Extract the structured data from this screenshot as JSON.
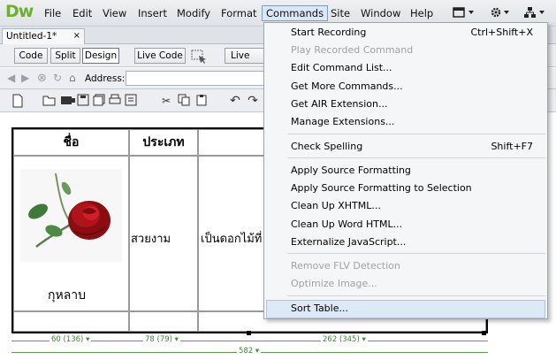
{
  "app": {
    "logo": "Dw"
  },
  "menubar": {
    "items": [
      "File",
      "Edit",
      "View",
      "Insert",
      "Modify",
      "Format",
      "Commands",
      "Site",
      "Window",
      "Help"
    ],
    "icons": [
      "layout-icon",
      "settings-icon",
      "site-icon"
    ]
  },
  "tab": {
    "title": "Untitled-1*",
    "close": "×"
  },
  "doc_toolbar": {
    "code": "Code",
    "split": "Split",
    "design": "Design",
    "live_code": "Live Code",
    "live_view": "Live View"
  },
  "address_bar": {
    "label": "Address:",
    "value": ""
  },
  "table": {
    "headers": [
      "ชื่อ",
      "ประเภท",
      ""
    ],
    "row1": {
      "caption": "กุหลาบ",
      "type": "สวยงาม",
      "desc": "เป็นดอกไม้ที่"
    },
    "widths": {
      "col1": "60 (136)",
      "col2": "78 (79)",
      "col3": "262 (345)",
      "total": "582"
    }
  },
  "commands_menu": {
    "items": [
      {
        "label": "Start Recording",
        "shortcut": "Ctrl+Shift+X",
        "enabled": true
      },
      {
        "label": "Play Recorded Command",
        "shortcut": "",
        "enabled": false
      },
      {
        "label": "Edit Command List...",
        "shortcut": "",
        "enabled": true
      },
      {
        "label": "Get More Commands...",
        "shortcut": "",
        "enabled": true
      },
      {
        "label": "Get AIR Extension...",
        "shortcut": "",
        "enabled": true
      },
      {
        "label": "Manage Extensions...",
        "shortcut": "",
        "enabled": true
      },
      {
        "label": "Check Spelling",
        "shortcut": "Shift+F7",
        "enabled": true
      },
      {
        "label": "Apply Source Formatting",
        "shortcut": "",
        "enabled": true
      },
      {
        "label": "Apply Source Formatting to Selection",
        "shortcut": "",
        "enabled": true
      },
      {
        "label": "Clean Up XHTML...",
        "shortcut": "",
        "enabled": true
      },
      {
        "label": "Clean Up Word HTML...",
        "shortcut": "",
        "enabled": true
      },
      {
        "label": "Externalize JavaScript...",
        "shortcut": "",
        "enabled": true
      },
      {
        "label": "Remove FLV Detection",
        "shortcut": "",
        "enabled": false
      },
      {
        "label": "Optimize Image...",
        "shortcut": "",
        "enabled": false
      },
      {
        "label": "Sort Table...",
        "shortcut": "",
        "enabled": true,
        "highlighted": true
      }
    ]
  },
  "colors": {
    "logo": "#6fae2f",
    "highlight": "#dde9f7",
    "ruler": "#5aa24a"
  }
}
